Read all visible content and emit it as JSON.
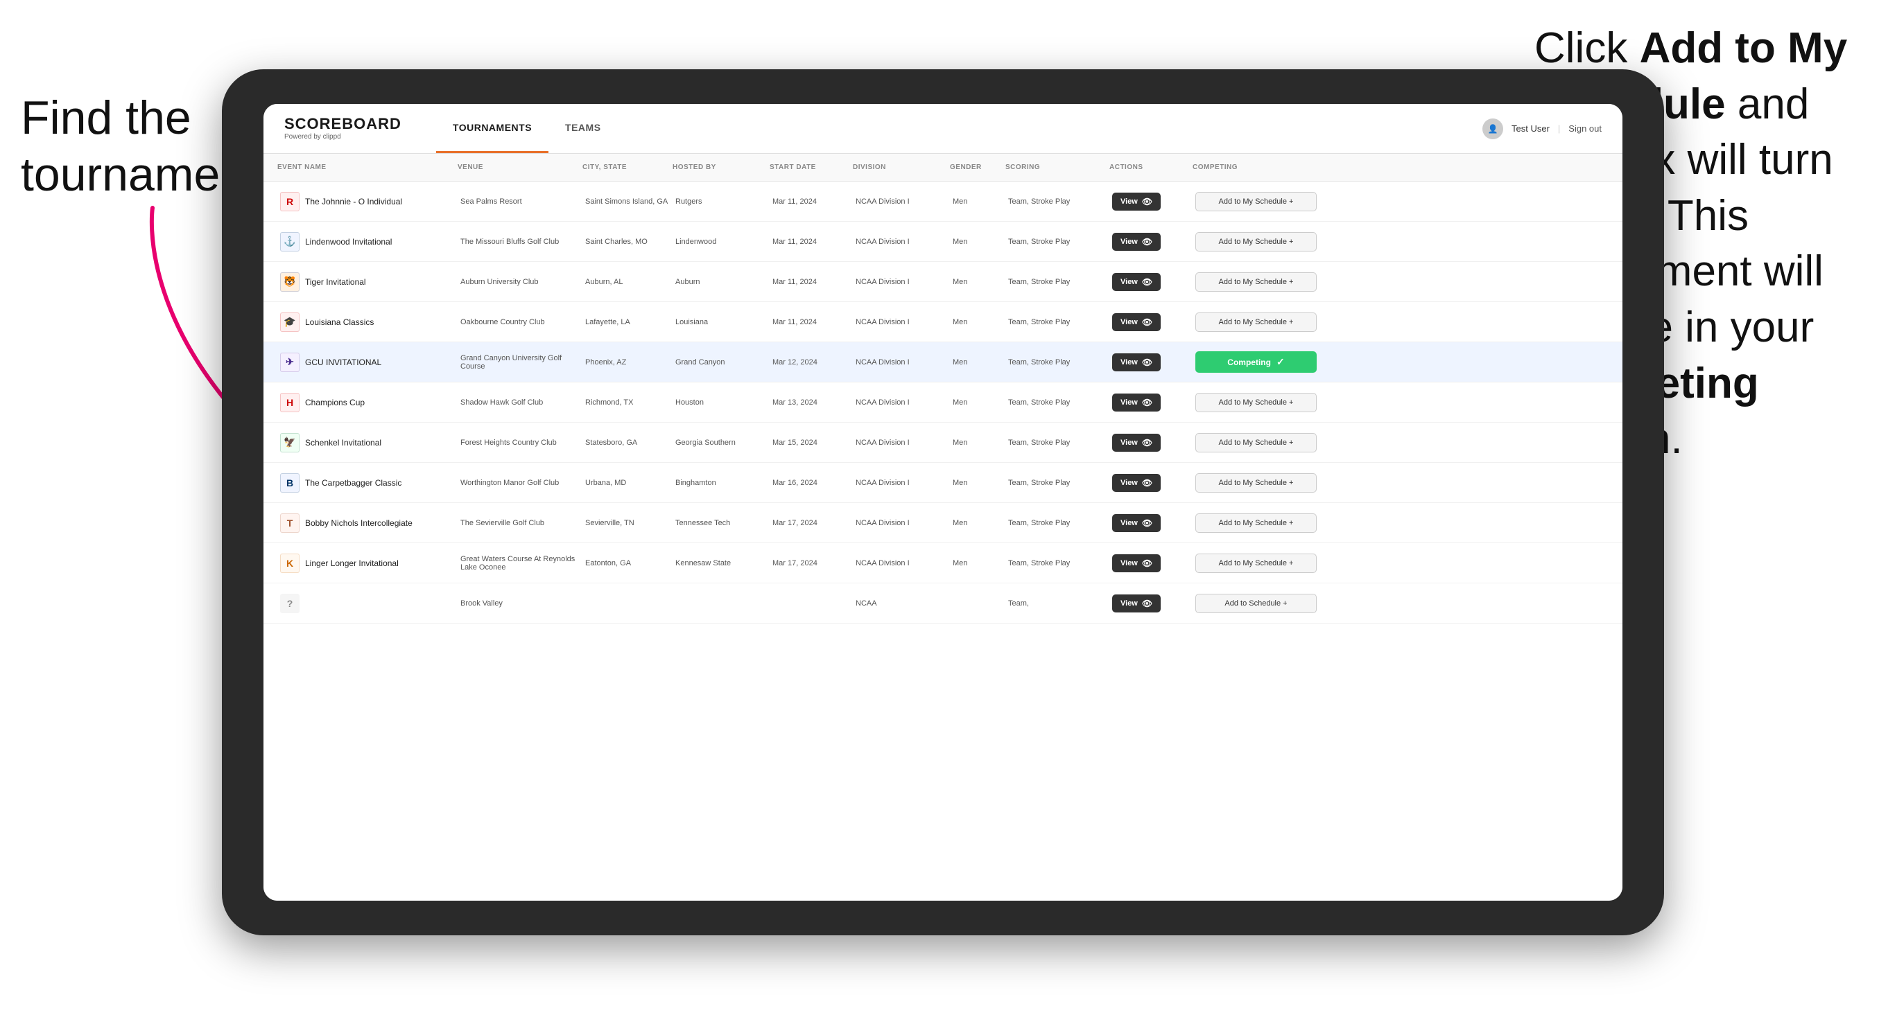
{
  "left_instruction": {
    "line1": "Find the",
    "line2": "tournament."
  },
  "right_instruction": {
    "text_before": "Click ",
    "bold1": "Add to My Schedule",
    "text_middle": " and the box will turn green. This tournament will now be in your ",
    "bold2": "Competing",
    "text_after": " section."
  },
  "app": {
    "logo": "SCOREBOARD",
    "logo_sub": "Powered by clippd",
    "nav": [
      "TOURNAMENTS",
      "TEAMS"
    ],
    "active_nav": "TOURNAMENTS",
    "user_label": "Test User",
    "sign_out_label": "Sign out"
  },
  "table": {
    "columns": [
      "EVENT NAME",
      "VENUE",
      "CITY, STATE",
      "HOSTED BY",
      "START DATE",
      "DIVISION",
      "GENDER",
      "SCORING",
      "ACTIONS",
      "COMPETING"
    ],
    "rows": [
      {
        "logo": "R",
        "logo_color": "#cc0000",
        "event": "The Johnnie - O Individual",
        "venue": "Sea Palms Resort",
        "city": "Saint Simons Island, GA",
        "hosted": "Rutgers",
        "date": "Mar 11, 2024",
        "division": "NCAA Division I",
        "gender": "Men",
        "scoring": "Team, Stroke Play",
        "action": "View",
        "competing_label": "Add to My Schedule +",
        "is_competing": false,
        "highlighted": false
      },
      {
        "logo": "L",
        "logo_color": "#003366",
        "event": "Lindenwood Invitational",
        "venue": "The Missouri Bluffs Golf Club",
        "city": "Saint Charles, MO",
        "hosted": "Lindenwood",
        "date": "Mar 11, 2024",
        "division": "NCAA Division I",
        "gender": "Men",
        "scoring": "Team, Stroke Play",
        "action": "View",
        "competing_label": "Add to My Schedule +",
        "is_competing": false,
        "highlighted": false
      },
      {
        "logo": "T",
        "logo_color": "#0033a0",
        "event": "Tiger Invitational",
        "venue": "Auburn University Club",
        "city": "Auburn, AL",
        "hosted": "Auburn",
        "date": "Mar 11, 2024",
        "division": "NCAA Division I",
        "gender": "Men",
        "scoring": "Team, Stroke Play",
        "action": "View",
        "competing_label": "Add to My Schedule +",
        "is_competing": false,
        "highlighted": false
      },
      {
        "logo": "L",
        "logo_color": "#cc0000",
        "event": "Louisiana Classics",
        "venue": "Oakbourne Country Club",
        "city": "Lafayette, LA",
        "hosted": "Louisiana",
        "date": "Mar 11, 2024",
        "division": "NCAA Division I",
        "gender": "Men",
        "scoring": "Team, Stroke Play",
        "action": "View",
        "competing_label": "Add to My Schedule +",
        "is_competing": false,
        "highlighted": false
      },
      {
        "logo": "G",
        "logo_color": "#4a2c8f",
        "event": "GCU INVITATIONAL",
        "venue": "Grand Canyon University Golf Course",
        "city": "Phoenix, AZ",
        "hosted": "Grand Canyon",
        "date": "Mar 12, 2024",
        "division": "NCAA Division I",
        "gender": "Men",
        "scoring": "Team, Stroke Play",
        "action": "View",
        "competing_label": "Competing",
        "is_competing": true,
        "highlighted": true
      },
      {
        "logo": "H",
        "logo_color": "#cc0000",
        "event": "Champions Cup",
        "venue": "Shadow Hawk Golf Club",
        "city": "Richmond, TX",
        "hosted": "Houston",
        "date": "Mar 13, 2024",
        "division": "NCAA Division I",
        "gender": "Men",
        "scoring": "Team, Stroke Play",
        "action": "View",
        "competing_label": "Add to My Schedule +",
        "is_competing": false,
        "highlighted": false
      },
      {
        "logo": "G",
        "logo_color": "#006633",
        "event": "Schenkel Invitational",
        "venue": "Forest Heights Country Club",
        "city": "Statesboro, GA",
        "hosted": "Georgia Southern",
        "date": "Mar 15, 2024",
        "division": "NCAA Division I",
        "gender": "Men",
        "scoring": "Team, Stroke Play",
        "action": "View",
        "competing_label": "Add to My Schedule +",
        "is_competing": false,
        "highlighted": false
      },
      {
        "logo": "B",
        "logo_color": "#003366",
        "event": "The Carpetbagger Classic",
        "venue": "Worthington Manor Golf Club",
        "city": "Urbana, MD",
        "hosted": "Binghamton",
        "date": "Mar 16, 2024",
        "division": "NCAA Division I",
        "gender": "Men",
        "scoring": "Team, Stroke Play",
        "action": "View",
        "competing_label": "Add to My Schedule +",
        "is_competing": false,
        "highlighted": false
      },
      {
        "logo": "T",
        "logo_color": "#a0522d",
        "event": "Bobby Nichols Intercollegiate",
        "venue": "The Sevierville Golf Club",
        "city": "Sevierville, TN",
        "hosted": "Tennessee Tech",
        "date": "Mar 17, 2024",
        "division": "NCAA Division I",
        "gender": "Men",
        "scoring": "Team, Stroke Play",
        "action": "View",
        "competing_label": "Add to My Schedule +",
        "is_competing": false,
        "highlighted": false
      },
      {
        "logo": "K",
        "logo_color": "#cc6600",
        "event": "Linger Longer Invitational",
        "venue": "Great Waters Course At Reynolds Lake Oconee",
        "city": "Eatonton, GA",
        "hosted": "Kennesaw State",
        "date": "Mar 17, 2024",
        "division": "NCAA Division I",
        "gender": "Men",
        "scoring": "Team, Stroke Play",
        "action": "View",
        "competing_label": "Add to My Schedule +",
        "is_competing": false,
        "highlighted": false
      },
      {
        "logo": "?",
        "logo_color": "#888",
        "event": "",
        "venue": "Brook Valley",
        "city": "",
        "hosted": "",
        "date": "",
        "division": "NCAA",
        "gender": "",
        "scoring": "Team,",
        "action": "View",
        "competing_label": "Add to Schedule +",
        "is_competing": false,
        "highlighted": false
      }
    ]
  }
}
